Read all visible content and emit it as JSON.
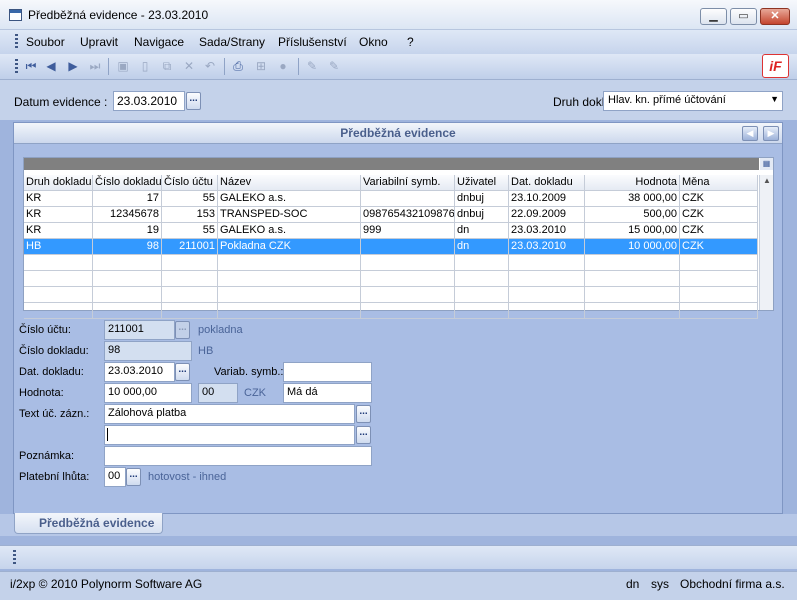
{
  "window": {
    "title": "Předběžná evidence - 23.03.2010"
  },
  "menu": [
    "Soubor",
    "Upravit",
    "Navigace",
    "Sada/Strany",
    "Příslušenství",
    "Okno",
    "?"
  ],
  "logo_text": "iF",
  "top": {
    "datum_label": "Datum evidence :",
    "datum_value": "23.03.2010",
    "druh_label": "Druh dokl.",
    "druh_value": "Hlav. kn. přímé účtování"
  },
  "panel": {
    "title": "Předběžná evidence"
  },
  "table": {
    "columns": [
      "Druh dokladu",
      "Číslo dokladu",
      "Číslo účtu",
      "Název",
      "Variabilní symb.",
      "Uživatel",
      "Dat. dokladu",
      "Hodnota",
      "Měna"
    ],
    "rows": [
      [
        "KR",
        "17",
        "55",
        "GALEKO a.s.",
        "",
        "dnbuj",
        "23.10.2009",
        "38 000,00",
        "CZK"
      ],
      [
        "KR",
        "12345678",
        "153",
        "TRANSPED-SOC",
        "098765432109876",
        "dnbuj",
        "22.09.2009",
        "500,00",
        "CZK"
      ],
      [
        "KR",
        "19",
        "55",
        "GALEKO a.s.",
        "999",
        "dn",
        "23.03.2010",
        "15 000,00",
        "CZK"
      ],
      [
        "HB",
        "98",
        "211001",
        "Pokladna CZK",
        "",
        "dn",
        "23.03.2010",
        "10 000,00",
        "CZK"
      ]
    ],
    "selected_row": 3
  },
  "detail": {
    "cislo_uctu_label": "Číslo účtu:",
    "cislo_uctu_value": "211001",
    "cislo_uctu_desc": "pokladna",
    "cislo_dokladu_label": "Číslo dokladu:",
    "cislo_dokladu_value": "98",
    "cislo_dokladu_desc": "HB",
    "dat_dokladu_label": "Dat. dokladu:",
    "dat_dokladu_value": "23.03.2010",
    "variab_label": "Variab. symb.:",
    "variab_value": "",
    "hodnota_label": "Hodnota:",
    "hodnota_value": "10 000,00",
    "kurz_value": "00",
    "mena_value": "CZK",
    "ma_da_value": "Má dá",
    "text_label": "Text úč. zázn.:",
    "text_value1": "Zálohová platba",
    "text_value2": "",
    "poznamka_label": "Poznámka:",
    "poznamka_value": "",
    "lhuta_label": "Platební lhůta:",
    "lhuta_value": "00",
    "lhuta_desc": "hotovost - ihned"
  },
  "tab": {
    "label": "Předběžná evidence"
  },
  "status": {
    "copyright": "i/2xp © 2010 Polynorm Software AG",
    "user": "dn",
    "system": "sys",
    "company": "Obchodní firma a.s."
  }
}
